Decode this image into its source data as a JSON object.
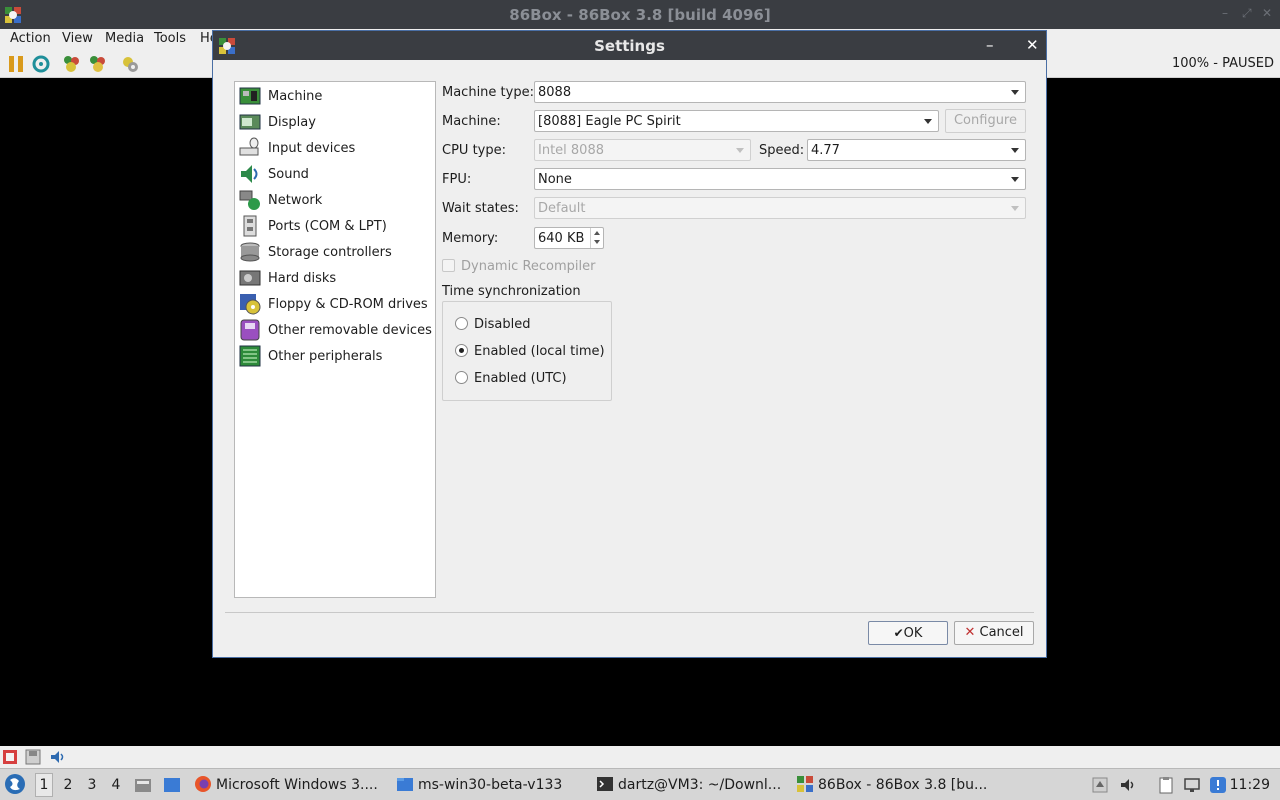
{
  "main_window": {
    "title": "86Box - 86Box 3.8 [build 4096]",
    "menu": [
      "Action",
      "View",
      "Media",
      "Tools",
      "He"
    ],
    "status": "100% - PAUSED"
  },
  "dialog": {
    "title": "Settings",
    "nav": [
      {
        "label": "Machine",
        "icon": "machine-icon"
      },
      {
        "label": "Display",
        "icon": "display-icon"
      },
      {
        "label": "Input devices",
        "icon": "input-devices-icon"
      },
      {
        "label": "Sound",
        "icon": "sound-icon"
      },
      {
        "label": "Network",
        "icon": "network-icon"
      },
      {
        "label": "Ports (COM & LPT)",
        "icon": "ports-icon"
      },
      {
        "label": "Storage controllers",
        "icon": "storage-icon"
      },
      {
        "label": "Hard disks",
        "icon": "hard-disk-icon"
      },
      {
        "label": "Floppy & CD-ROM drives",
        "icon": "floppy-cdrom-icon"
      },
      {
        "label": "Other removable devices",
        "icon": "removable-icon"
      },
      {
        "label": "Other peripherals",
        "icon": "peripherals-icon"
      }
    ],
    "fields": {
      "machine_type_label": "Machine type:",
      "machine_type_value": "8088",
      "machine_label": "Machine:",
      "machine_value": "[8088] Eagle PC Spirit",
      "configure_label": "Configure",
      "cpu_type_label": "CPU type:",
      "cpu_type_value": "Intel 8088",
      "speed_label": "Speed:",
      "speed_value": "4.77",
      "fpu_label": "FPU:",
      "fpu_value": "None",
      "wait_states_label": "Wait states:",
      "wait_states_value": "Default",
      "memory_label": "Memory:",
      "memory_value": "640 KB",
      "dynarec_label": "Dynamic Recompiler",
      "time_sync_label": "Time synchronization",
      "time_sync_options": [
        "Disabled",
        "Enabled (local time)",
        "Enabled (UTC)"
      ],
      "time_sync_selected": "Enabled (local time)"
    },
    "ok_label": "OK",
    "cancel_label": "Cancel"
  },
  "taskbar": {
    "workspaces": [
      "1",
      "2",
      "3",
      "4"
    ],
    "active_workspace": "1",
    "tasks": [
      {
        "label": "Microsoft Windows 3....",
        "icon": "firefox-icon"
      },
      {
        "label": "ms-win30-beta-v133",
        "icon": "folder-icon"
      },
      {
        "label": "dartz@VM3: ~/Downl...",
        "icon": "terminal-icon"
      },
      {
        "label": "86Box - 86Box 3.8 [bu...",
        "icon": "86box-icon"
      }
    ],
    "clock": "11:29"
  },
  "colors": {
    "titlebar": "#3a3d42",
    "dialog_border": "#4a6fa5",
    "window_bg": "#efefef"
  }
}
